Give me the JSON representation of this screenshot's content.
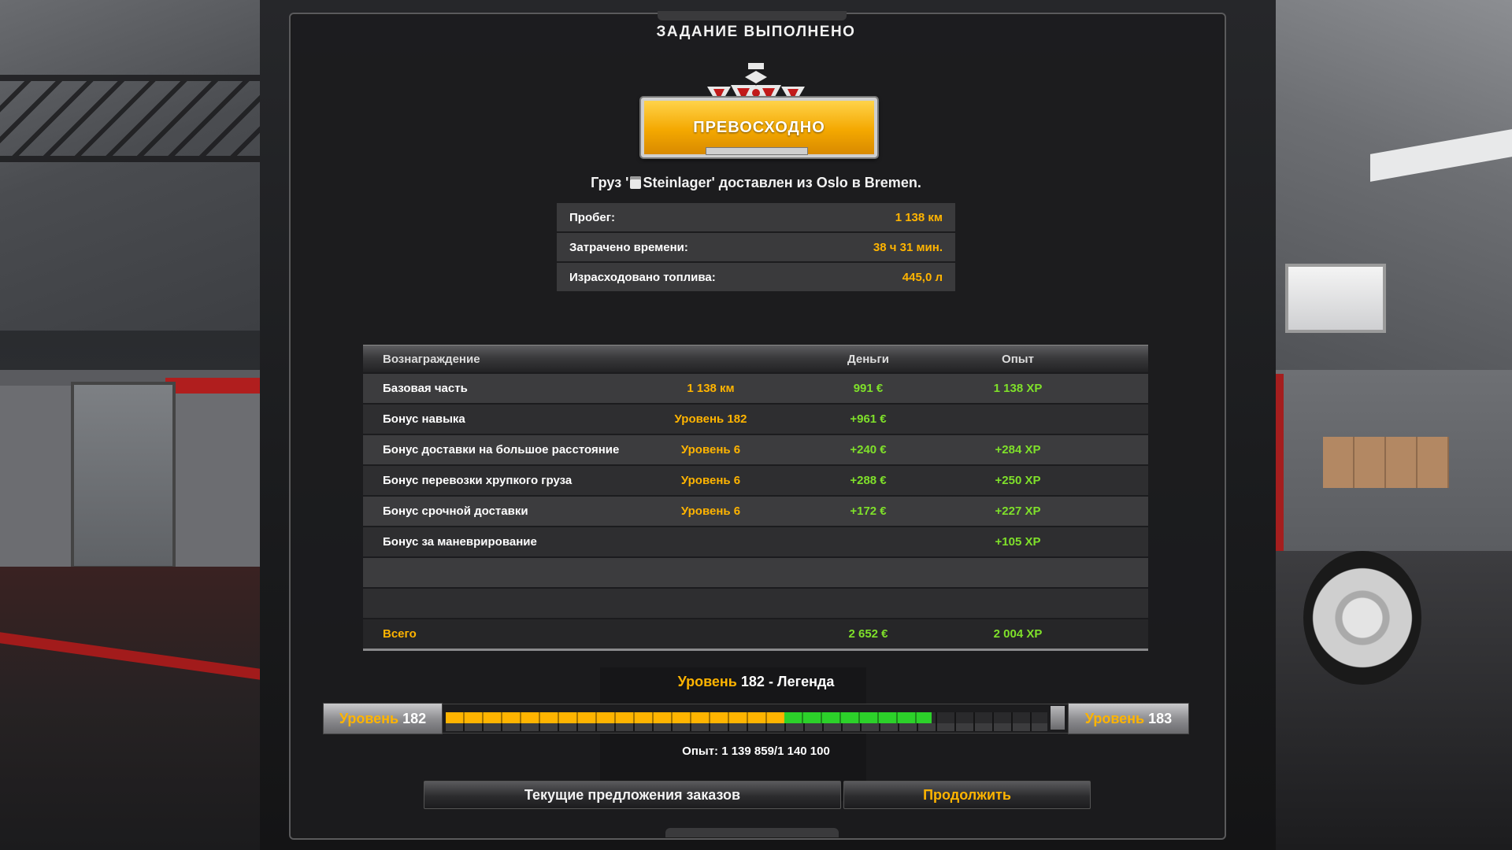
{
  "title": "ЗАДАНИЕ ВЫПОЛНЕНО",
  "rating": "ПРЕВОСХОДНО",
  "cargo": {
    "prefix": "Груз '",
    "name": "Steinlager",
    "middle": "' доставлен из ",
    "from": "Oslo",
    "between": " в ",
    "to": "Bremen",
    "suffix": ".",
    "icon": "beer-icon"
  },
  "stats": [
    {
      "label": "Пробег:",
      "value": "1 138 км"
    },
    {
      "label": "Затрачено времени:",
      "value": "38 ч 31 мин."
    },
    {
      "label": "Израсходовано топлива:",
      "value": "445,0 л"
    }
  ],
  "rewards": {
    "headers": {
      "reward": "Вознаграждение",
      "money": "Деньги",
      "xp": "Опыт"
    },
    "rows": [
      {
        "name": "Базовая часть",
        "detail": "1 138 км",
        "money": "991 €",
        "xp": "1 138 XP"
      },
      {
        "name": "Бонус навыка",
        "detail": "Уровень 182",
        "money": "+961 €",
        "xp": ""
      },
      {
        "name": "Бонус доставки на большое расстояние",
        "detail": "Уровень 6",
        "money": "+240 €",
        "xp": "+284 XP"
      },
      {
        "name": "Бонус перевозки хрупкого груза",
        "detail": "Уровень 6",
        "money": "+288 €",
        "xp": "+250 XP"
      },
      {
        "name": "Бонус срочной доставки",
        "detail": "Уровень 6",
        "money": "+172 €",
        "xp": "+227 XP"
      },
      {
        "name": "Бонус за маневрирование",
        "detail": "",
        "money": "",
        "xp": "+105 XP"
      },
      {
        "name": "",
        "detail": "",
        "money": "",
        "xp": ""
      },
      {
        "name": "",
        "detail": "",
        "money": "",
        "xp": ""
      }
    ],
    "total": {
      "name": "Всего",
      "money": "2 652 €",
      "xp": "2 004 XP"
    }
  },
  "level": {
    "label": "Уровень",
    "number": "182",
    "rank": " - Легенда",
    "current": "182",
    "next": "183",
    "progress_before": 0.563,
    "progress_gained": 0.807,
    "xp_text": "Опыт: 1 139 859/1 140 100"
  },
  "buttons": {
    "offers": "Текущие предложения заказов",
    "continue": "Продолжить"
  },
  "colors": {
    "accent": "#ffb400",
    "money": "#7fe02a",
    "xp_gain": "#2cd12a"
  }
}
